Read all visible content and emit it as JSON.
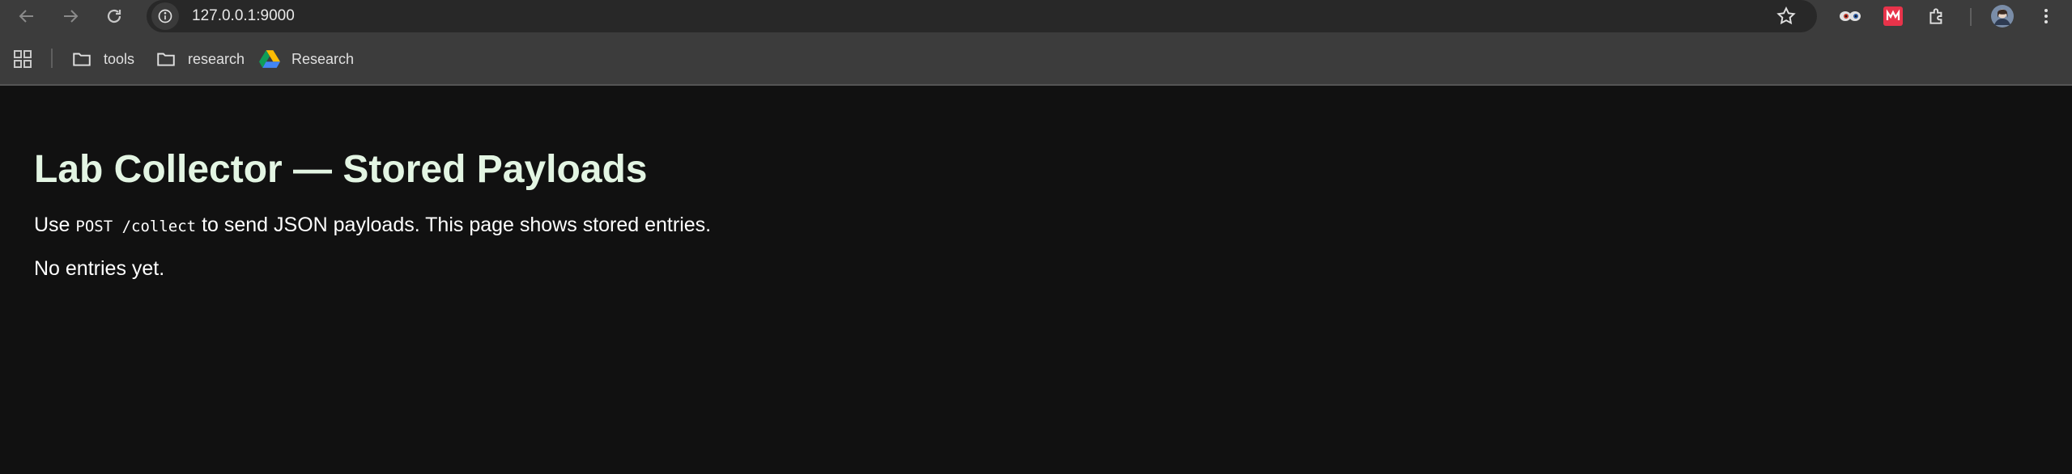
{
  "browser": {
    "url": "127.0.0.1:9000",
    "bookmarks": [
      {
        "label": "tools",
        "icon": "folder-icon"
      },
      {
        "label": "research",
        "icon": "folder-icon"
      },
      {
        "label": "Research",
        "icon": "google-drive-icon"
      }
    ],
    "extensions": [
      "eyes-extension-icon",
      "red-extension-icon",
      "puzzle-icon",
      "profile-avatar",
      "kebab-menu-icon"
    ]
  },
  "page": {
    "title": "Lab Collector — Stored Payloads",
    "intro_before": "Use ",
    "intro_code": "POST /collect",
    "intro_after": " to send JSON payloads. This page shows stored entries.",
    "empty_message": "No entries yet."
  },
  "colors": {
    "background": "#111111",
    "title": "#e3f5e3",
    "chrome": "#3c3c3c"
  }
}
